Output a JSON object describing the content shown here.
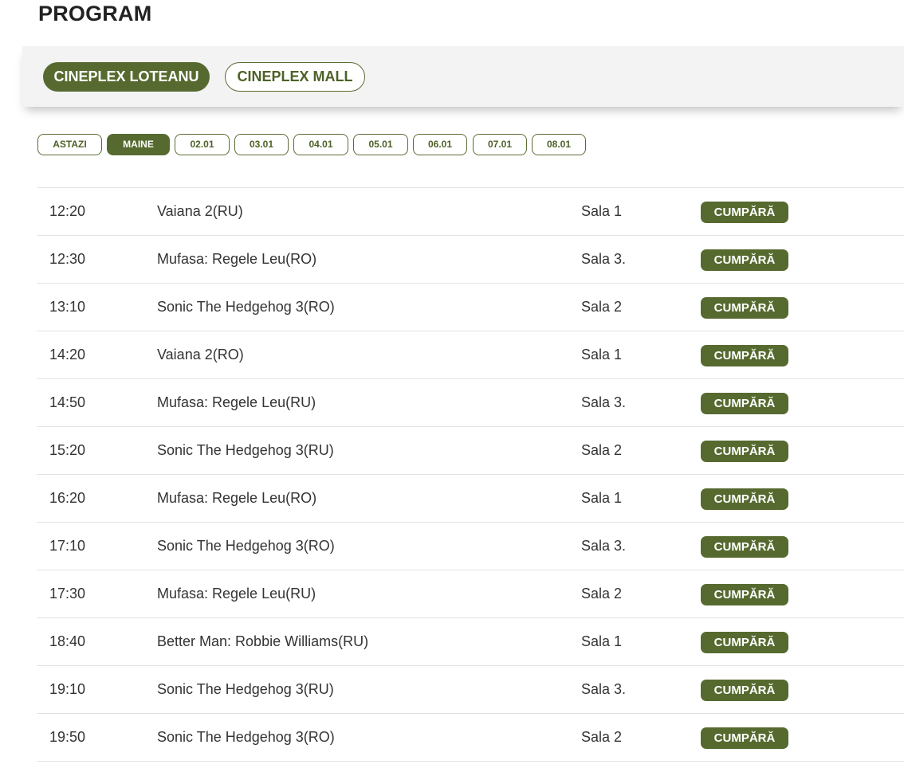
{
  "page": {
    "title": "PROGRAM"
  },
  "cinemas": [
    {
      "label": "CINEPLEX LOTEANU",
      "active": true
    },
    {
      "label": "CINEPLEX MALL",
      "active": false
    }
  ],
  "dates": [
    {
      "label": "ASTAZI",
      "active": false
    },
    {
      "label": "MAINE",
      "active": true
    },
    {
      "label": "02.01",
      "active": false
    },
    {
      "label": "03.01",
      "active": false
    },
    {
      "label": "04.01",
      "active": false
    },
    {
      "label": "05.01",
      "active": false
    },
    {
      "label": "06.01",
      "active": false
    },
    {
      "label": "07.01",
      "active": false
    },
    {
      "label": "08.01",
      "active": false
    }
  ],
  "schedule": [
    {
      "time": "12:20",
      "title": "Vaiana 2(RU)",
      "hall": "Sala 1",
      "buy_label": "CUMPĂRĂ"
    },
    {
      "time": "12:30",
      "title": "Mufasa: Regele Leu(RO)",
      "hall": "Sala 3.",
      "buy_label": "CUMPĂRĂ"
    },
    {
      "time": "13:10",
      "title": "Sonic The Hedgehog 3(RO)",
      "hall": "Sala 2",
      "buy_label": "CUMPĂRĂ"
    },
    {
      "time": "14:20",
      "title": "Vaiana 2(RO)",
      "hall": "Sala 1",
      "buy_label": "CUMPĂRĂ"
    },
    {
      "time": "14:50",
      "title": "Mufasa: Regele Leu(RU)",
      "hall": "Sala 3.",
      "buy_label": "CUMPĂRĂ"
    },
    {
      "time": "15:20",
      "title": "Sonic The Hedgehog 3(RU)",
      "hall": "Sala 2",
      "buy_label": "CUMPĂRĂ"
    },
    {
      "time": "16:20",
      "title": "Mufasa: Regele Leu(RO)",
      "hall": "Sala 1",
      "buy_label": "CUMPĂRĂ"
    },
    {
      "time": "17:10",
      "title": "Sonic The Hedgehog 3(RO)",
      "hall": "Sala 3.",
      "buy_label": "CUMPĂRĂ"
    },
    {
      "time": "17:30",
      "title": "Mufasa: Regele Leu(RU)",
      "hall": "Sala 2",
      "buy_label": "CUMPĂRĂ"
    },
    {
      "time": "18:40",
      "title": "Better Man: Robbie Williams(RU)",
      "hall": "Sala 1",
      "buy_label": "CUMPĂRĂ"
    },
    {
      "time": "19:10",
      "title": "Sonic The Hedgehog 3(RU)",
      "hall": "Sala 3.",
      "buy_label": "CUMPĂRĂ"
    },
    {
      "time": "19:50",
      "title": "Sonic The Hedgehog 3(RO)",
      "hall": "Sala 2",
      "buy_label": "CUMPĂRĂ"
    }
  ],
  "colors": {
    "accent": "#566a2f",
    "panel_bg": "#f3f3f3",
    "divider": "#e3e3e3"
  }
}
